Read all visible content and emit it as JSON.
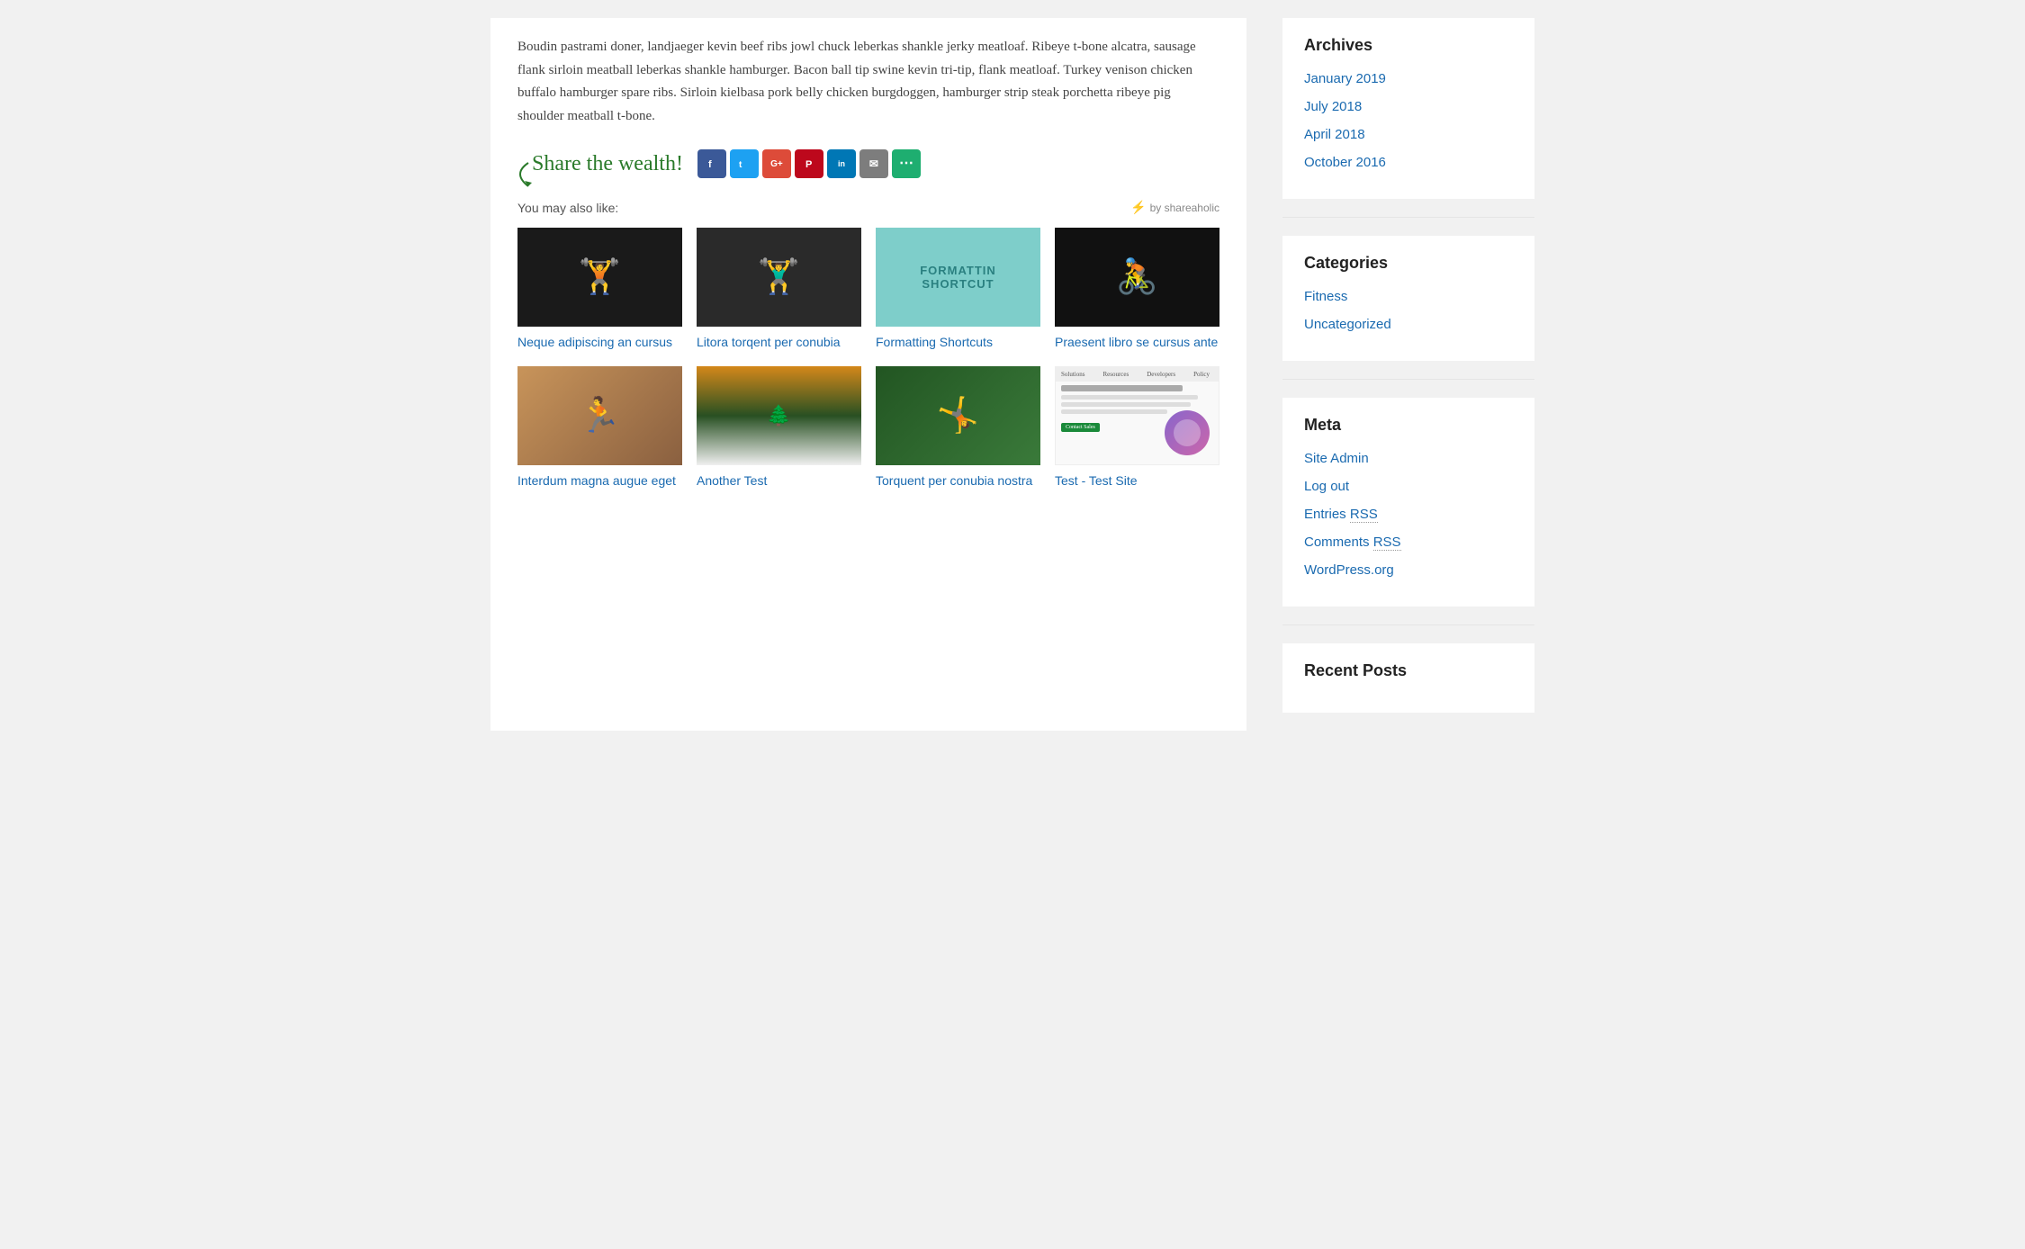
{
  "main": {
    "article_body": "Boudin pastrami doner, landjaeger kevin beef ribs jowl chuck leberkas shankle jerky meatloaf. Ribeye t-bone alcatra, sausage flank sirloin meatball leberkas shankle hamburger. Bacon ball tip swine kevin tri-tip, flank meatloaf. Turkey venison chicken buffalo hamburger spare ribs. Sirloin kielbasa pork belly chicken burgdoggen, hamburger strip steak porchetta ribeye pig shoulder meatball t-bone.",
    "share": {
      "label": "Share the wealth!",
      "icons": [
        {
          "name": "facebook",
          "class": "facebook",
          "symbol": "f"
        },
        {
          "name": "twitter",
          "class": "twitter",
          "symbol": "t"
        },
        {
          "name": "google-plus",
          "class": "google",
          "symbol": "G+"
        },
        {
          "name": "pinterest",
          "class": "pinterest",
          "symbol": "P"
        },
        {
          "name": "linkedin",
          "class": "linkedin",
          "symbol": "in"
        },
        {
          "name": "email",
          "class": "email",
          "symbol": "✉"
        },
        {
          "name": "more",
          "class": "more",
          "symbol": "…"
        }
      ]
    },
    "you_may_like": {
      "label": "You may also like:",
      "shareaholic": "by shareaholic",
      "related": [
        {
          "id": 1,
          "title": "Neque adipiscing an cursus",
          "img_type": "weights"
        },
        {
          "id": 2,
          "title": "Litora torqent per conubia",
          "img_type": "barbell"
        },
        {
          "id": 3,
          "title": "Formatting Shortcuts",
          "img_type": "formatting"
        },
        {
          "id": 4,
          "title": "Praesent libro se cursus ante",
          "img_type": "cycling"
        },
        {
          "id": 5,
          "title": "Interdum magna augue eget",
          "img_type": "man-sitting"
        },
        {
          "id": 6,
          "title": "Another Test",
          "img_type": "winter"
        },
        {
          "id": 7,
          "title": "Torquent per conubia nostra",
          "img_type": "two-people"
        },
        {
          "id": 8,
          "title": "Test - Test Site",
          "img_type": "website"
        }
      ]
    }
  },
  "sidebar": {
    "archives": {
      "title": "Archives",
      "items": [
        {
          "label": "January 2019",
          "url": "#"
        },
        {
          "label": "July 2018",
          "url": "#"
        },
        {
          "label": "April 2018",
          "url": "#"
        },
        {
          "label": "October 2016",
          "url": "#"
        }
      ]
    },
    "categories": {
      "title": "Categories",
      "items": [
        {
          "label": "Fitness",
          "url": "#"
        },
        {
          "label": "Uncategorized",
          "url": "#"
        }
      ]
    },
    "meta": {
      "title": "Meta",
      "items": [
        {
          "label": "Site Admin",
          "url": "#"
        },
        {
          "label": "Log out",
          "url": "#"
        },
        {
          "label": "Entries RSS",
          "url": "#",
          "abbr": "RSS"
        },
        {
          "label": "Comments RSS",
          "url": "#",
          "abbr": "RSS"
        },
        {
          "label": "WordPress.org",
          "url": "#"
        }
      ]
    },
    "recent_posts": {
      "title": "Recent Posts"
    }
  },
  "formatting_img": {
    "line1": "FORMATTIN",
    "line2": "SHORTCUT"
  }
}
